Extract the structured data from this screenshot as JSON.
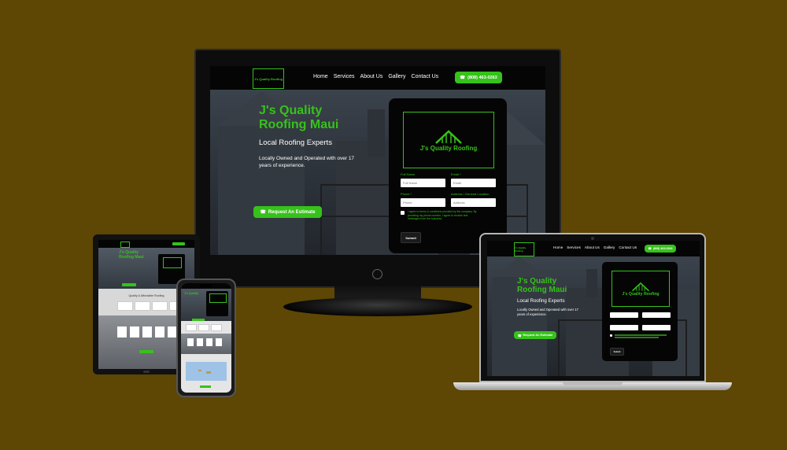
{
  "site": {
    "logo_text": "J's Quality Roofing",
    "nav_items": [
      "Home",
      "Services",
      "About Us",
      "Gallery",
      "Contact Us"
    ],
    "phone": "(808) 463-0263",
    "hero_title_line1": "J's Quality",
    "hero_title_line2": "Roofing Maui",
    "hero_subtitle": "Local Roofing Experts",
    "hero_desc_line1": "Locally Owned and Operated with over 17",
    "hero_desc_line2": "years of experience.",
    "cta_label": "Request An Estimate",
    "form": {
      "logo_text": "J's Quality Roofing",
      "full_name_label": "Full Name",
      "full_name_placeholder": "Full Name",
      "email_label": "Email *",
      "email_placeholder": "Email",
      "phone_label": "Phone *",
      "phone_placeholder": "Phone",
      "address_label": "Address / General Location",
      "address_placeholder": "Address",
      "terms_line1": "I agree to terms & conditions provided by the company. By",
      "terms_line2": "providing my phone number, I agree to receive text",
      "terms_line3": "messages from the business.",
      "submit_label": "Submit"
    },
    "section_title": "Quality & Affordable Roofing"
  },
  "colors": {
    "background": "#5e4604",
    "accent_green": "#36c21a",
    "nav_black": "#050505"
  },
  "icons": {
    "phone": "phone-icon",
    "roof": "roof-logo-icon"
  }
}
